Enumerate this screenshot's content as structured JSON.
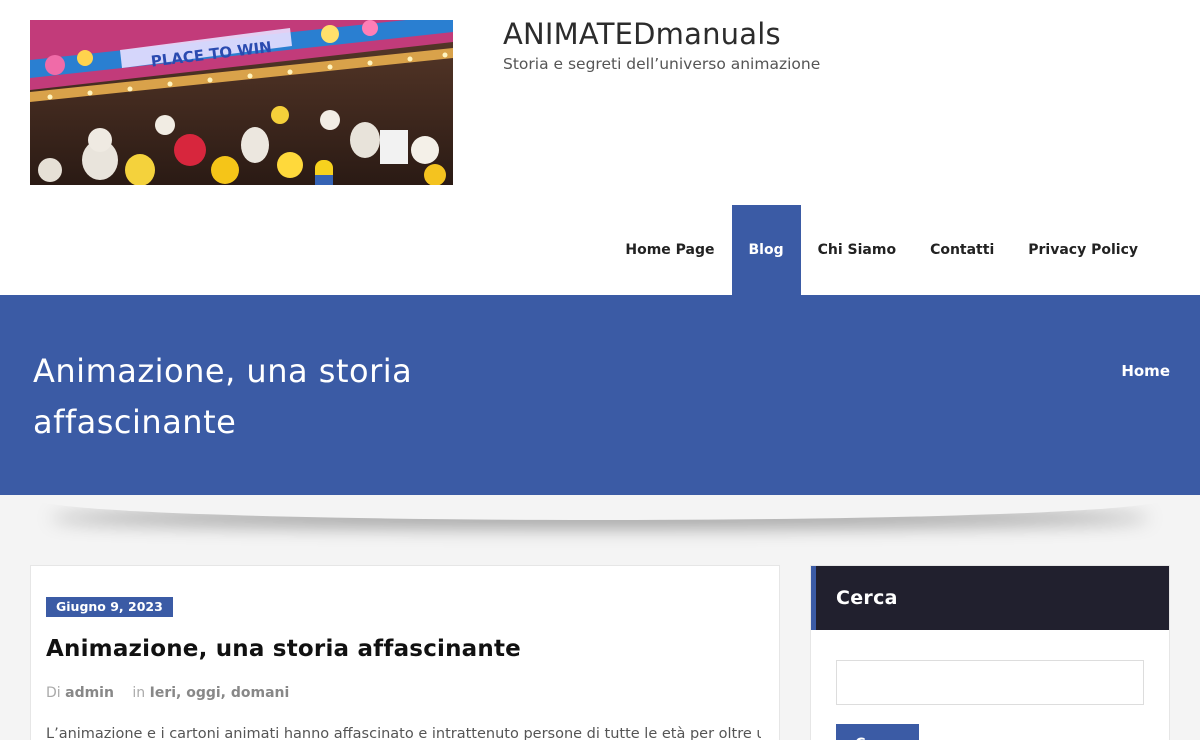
{
  "site": {
    "title": "ANIMATEDmanuals",
    "tagline": "Storia e segreti dell’universo animazione",
    "logo_sign": "PLACE TO WIN"
  },
  "nav": {
    "items": [
      {
        "label": "Home Page",
        "active": false
      },
      {
        "label": "Blog",
        "active": true
      },
      {
        "label": "Chi Siamo",
        "active": false
      },
      {
        "label": "Contatti",
        "active": false
      },
      {
        "label": "Privacy Policy",
        "active": false
      }
    ]
  },
  "banner": {
    "title": "Animazione, una storia affascinante",
    "breadcrumb": "Home"
  },
  "post": {
    "date": "Giugno 9, 2023",
    "title": "Animazione, una storia affascinante",
    "meta_by": "Di",
    "author": "admin",
    "meta_in": "in",
    "categories": "Ieri, oggi, domani",
    "excerpt": "L’animazione e i cartoni animati hanno affascinato e intrattenuto persone di tutte le età per oltre un"
  },
  "sidebar": {
    "widget_title": "Cerca",
    "search_value": "",
    "search_placeholder": "",
    "search_button": "Cerca"
  },
  "colors": {
    "accent": "#3b5ba5",
    "widget_header": "#21202e",
    "page_bg": "#f4f4f4"
  }
}
